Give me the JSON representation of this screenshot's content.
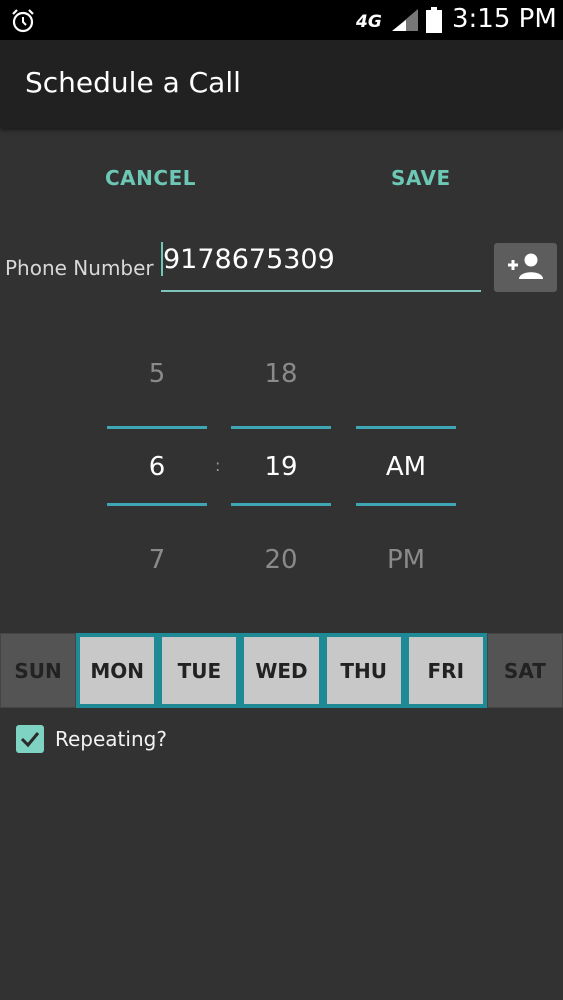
{
  "status_bar": {
    "network": "4G",
    "time": "3:15 PM",
    "icons": [
      "alarm-icon",
      "signal-icon",
      "battery-icon"
    ]
  },
  "app_bar": {
    "title": "Schedule a Call"
  },
  "actions": {
    "cancel_label": "CANCEL",
    "save_label": "SAVE"
  },
  "phone": {
    "label": "Phone Number",
    "value": "9178675309",
    "contact_icon": "add-contact-icon"
  },
  "time_picker": {
    "hour": {
      "prev": "5",
      "selected": "6",
      "next": "7"
    },
    "separator": ":",
    "minute": {
      "prev": "18",
      "selected": "19",
      "next": "20"
    },
    "ampm": {
      "prev": "",
      "selected": "AM",
      "next": "PM"
    }
  },
  "days": [
    {
      "label": "SUN",
      "selected": false
    },
    {
      "label": "MON",
      "selected": true
    },
    {
      "label": "TUE",
      "selected": true
    },
    {
      "label": "WED",
      "selected": true
    },
    {
      "label": "THU",
      "selected": true
    },
    {
      "label": "FRI",
      "selected": true
    },
    {
      "label": "SAT",
      "selected": false
    }
  ],
  "repeating": {
    "label": "Repeating?",
    "checked": true
  },
  "colors": {
    "accent": "#6cc7b5",
    "picker_line": "#3fa6b5",
    "day_selected_border": "#1e8a96",
    "background": "#323232"
  }
}
